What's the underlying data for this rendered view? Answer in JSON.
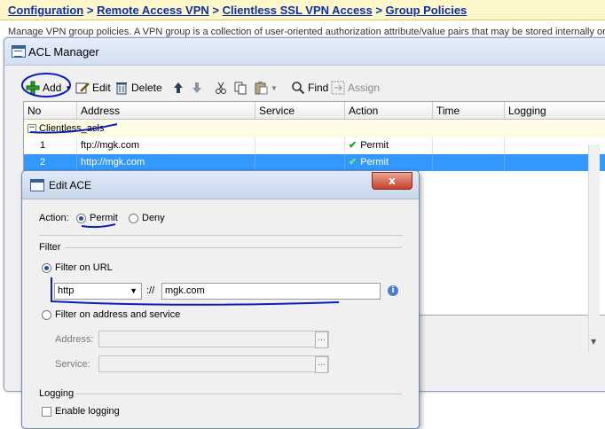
{
  "breadcrumb": {
    "items": [
      "Configuration",
      "Remote Access VPN",
      "Clientless SSL VPN Access",
      "Group Policies"
    ],
    "separator": ">"
  },
  "background_description": "Manage VPN group policies. A VPN group is a collection of user-oriented authorization attribute/value pairs that may be stored internally or",
  "acl_manager": {
    "title": "ACL Manager",
    "toolbar": {
      "add_label": "Add",
      "edit_label": "Edit",
      "delete_label": "Delete",
      "find_label": "Find",
      "assign_label": "Assign"
    },
    "columns": [
      "No",
      "Address",
      "Service",
      "Action",
      "Time",
      "Logging"
    ],
    "group": {
      "name": "Clientless_acls"
    },
    "rows": [
      {
        "no": "1",
        "address": "ftp://mgk.com",
        "action": "Permit"
      },
      {
        "no": "2",
        "address": "http://mgk.com",
        "action": "Permit"
      }
    ]
  },
  "edit_ace": {
    "title": "Edit ACE",
    "close_label": "x",
    "action_label": "Action:",
    "permit_label": "Permit",
    "deny_label": "Deny",
    "filter_label": "Filter",
    "filter_url_label": "Filter on URL",
    "protocol_value": "http",
    "url_separator": "://",
    "url_value": "mgk.com",
    "filter_addr_label": "Filter on address and service",
    "address_label": "Address:",
    "service_label": "Service:",
    "browse_label": "...",
    "logging_label": "Logging",
    "enable_logging_label": "Enable logging"
  },
  "colors": {
    "link": "#0a2fa8",
    "selection": "#3399ff",
    "group_row": "#fdfbe3",
    "annotation_ink": "#0b1fb8"
  }
}
